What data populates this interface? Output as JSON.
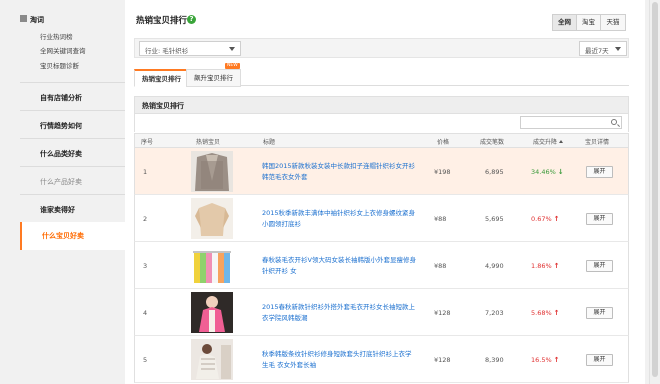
{
  "sidebar": {
    "head": "淘词",
    "sub_items": [
      "行业热词榜",
      "全网关键词查询",
      "宝贝标题诊断"
    ],
    "items": [
      "自有店铺分析",
      "行情趋势如何",
      "什么品类好卖",
      "什么产品好卖",
      "谁家卖得好"
    ],
    "active": "什么宝贝好卖"
  },
  "main": {
    "title": "热销宝贝排行",
    "help": "?",
    "scope_tabs": [
      "全网",
      "淘宝",
      "天猫"
    ],
    "scope_active": "全网",
    "category": "行业: 毛针织衫",
    "period": "最近7天",
    "tabs": [
      "热销宝贝排行",
      "飙升宝贝排行"
    ],
    "new_tag": "NEW",
    "box_title": "热销宝贝排行",
    "search_placeholder": ""
  },
  "table": {
    "headers": [
      "序号",
      "热销宝贝",
      "标题",
      "价格",
      "成交笔数",
      "成交升降",
      "宝贝详情"
    ],
    "button_label": "展开",
    "rows": [
      {
        "rank": "1",
        "title": "韩国2015新款秋装女装中长款扣子连帽针织衫女开衫 韩范毛衣女外套",
        "price": "¥198",
        "count": "6,895",
        "rate": "34.46%",
        "dir": "down",
        "color": "#3a9a3a"
      },
      {
        "rank": "2",
        "title": "2015秋季新款丰满体中袖针织衫女上衣修身螺纹紧身 小圆领打底衫",
        "price": "¥88",
        "count": "5,695",
        "rate": "0.67%",
        "dir": "up",
        "color": "#e03030"
      },
      {
        "rank": "3",
        "title": "春秋装毛衣开衫V领大码女装长袖韩版小外套显瘦修身 针织开衫 女",
        "price": "¥88",
        "count": "4,990",
        "rate": "1.86%",
        "dir": "up",
        "color": "#e03030"
      },
      {
        "rank": "4",
        "title": "2015春秋新款针织衫外搭外套毛衣开衫女长袖短款上 衣学院风韩版潮",
        "price": "¥128",
        "count": "7,203",
        "rate": "5.68%",
        "dir": "up",
        "color": "#e03030"
      },
      {
        "rank": "5",
        "title": "秋季韩版条纹针织衫修身短款套头打底针织衫上衣学生毛 衣女外套长袖",
        "price": "¥128",
        "count": "8,390",
        "rate": "16.5%",
        "dir": "up",
        "color": "#e03030"
      }
    ]
  },
  "colors": {
    "accent": "#ff7a22",
    "link": "#1a6fcf",
    "up": "#e03030",
    "down": "#3a9a3a"
  }
}
